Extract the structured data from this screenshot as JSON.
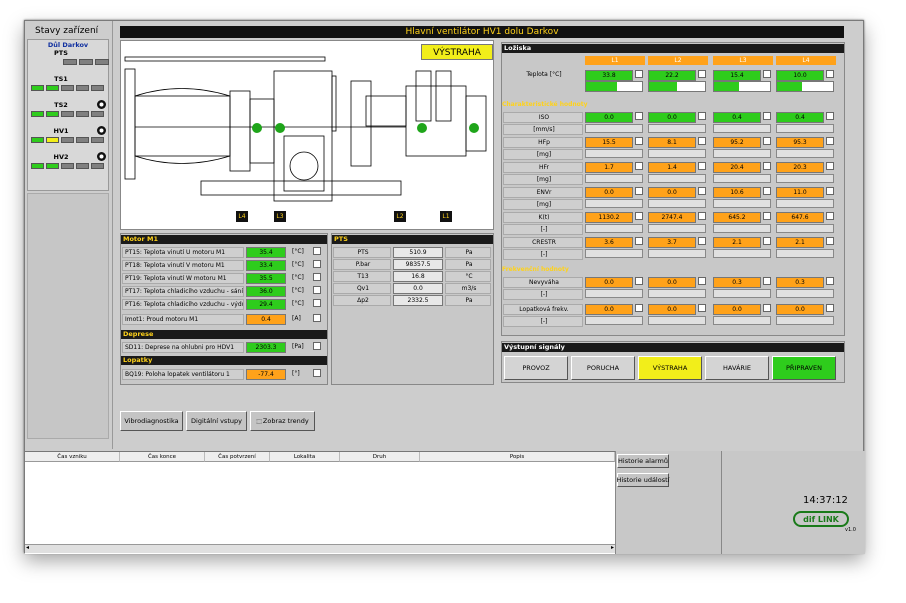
{
  "left_panel": {
    "title": "Stavy zařízení",
    "mine": "Důl Darkov",
    "items": [
      {
        "label": "PTS",
        "icon": false,
        "lamps": [
          "#808080",
          "#808080",
          "#808080"
        ]
      },
      {
        "label": "TS1",
        "icon": false,
        "lamps": [
          "#2ecc1c",
          "#2ecc1c",
          "#808080",
          "#808080",
          "#808080"
        ]
      },
      {
        "label": "TS2",
        "icon": true,
        "lamps": [
          "#2ecc1c",
          "#2ecc1c",
          "#808080",
          "#808080",
          "#808080"
        ]
      },
      {
        "label": "HV1",
        "icon": true,
        "lamps": [
          "#2ecc1c",
          "#f2ee1a",
          "#808080",
          "#808080",
          "#808080"
        ]
      },
      {
        "label": "HV2",
        "icon": true,
        "lamps": [
          "#2ecc1c",
          "#2ecc1c",
          "#808080",
          "#808080",
          "#808080"
        ]
      }
    ]
  },
  "header": {
    "title": "Hlavní ventilátor HV1 dolu Darkov"
  },
  "diagram": {
    "warning": "VÝSTRAHA",
    "bearings": [
      "L4",
      "L3",
      "L2",
      "L1"
    ]
  },
  "motor": {
    "title": "Motor M1",
    "rows": [
      {
        "label": "PT15: Teplota vinutí U motoru M1",
        "value": "35.4",
        "unit": "[°C]",
        "color": "#2ecc1c"
      },
      {
        "label": "PT18: Teplota vinutí V motoru M1",
        "value": "33.4",
        "unit": "[°C]",
        "color": "#2ecc1c"
      },
      {
        "label": "PT19: Teplota vinutí W motoru M1",
        "value": "35.5",
        "unit": "[°C]",
        "color": "#2ecc1c"
      },
      {
        "label": "PT17: Teplota chladicího vzduchu - sání",
        "value": "36.0",
        "unit": "[°C]",
        "color": "#2ecc1c"
      },
      {
        "label": "PT16: Teplota chladicího vzduchu - výdu",
        "value": "29.4",
        "unit": "[°C]",
        "color": "#2ecc1c"
      },
      {
        "label": "Imot1: Proud motoru M1",
        "value": "0.4",
        "unit": "[A]",
        "color": "#ffa21a"
      }
    ]
  },
  "deprese": {
    "title": "Deprese",
    "label": "SD11: Deprese na ohlubni pro HDV1",
    "value": "2303.3",
    "unit": "[Pa]"
  },
  "lopatky": {
    "title": "Lopatky",
    "label": "BQ19: Poloha lopatek ventilátoru 1",
    "value": "-77.4",
    "unit": "[°]"
  },
  "pts": {
    "title": "PTS",
    "rows": [
      {
        "label": "PTS",
        "value": "510.9",
        "unit": "Pa"
      },
      {
        "label": "P.bar",
        "value": "98357.5",
        "unit": "Pa"
      },
      {
        "label": "T13",
        "value": "16.8",
        "unit": "°C"
      },
      {
        "label": "Qv1",
        "value": "0.0",
        "unit": "m3/s"
      },
      {
        "label": "Δp2",
        "value": "2332.5",
        "unit": "Pa"
      }
    ]
  },
  "bottom_buttons": [
    "Vibrodiagnostika",
    "Digitální vstupy",
    "Zobraz trendy"
  ],
  "bearings": {
    "title": "Ložiska",
    "cols": [
      "L1",
      "L2",
      "L3",
      "L4"
    ],
    "teplota_label": "Teplota",
    "teplota_unit": "[°C]",
    "teplota": [
      "33.8",
      "22.2",
      "15.4",
      "10.0"
    ],
    "teplota_fill": [
      0.55,
      0.5,
      0.45,
      0.45
    ]
  },
  "char": {
    "title": "Charakteristické hodnoty",
    "rows": [
      {
        "label": "ISO",
        "unit": "[mm/s]",
        "values": [
          "0.0",
          "0.0",
          "0.4",
          "0.4"
        ],
        "colors": [
          "#2ecc1c",
          "#2ecc1c",
          "#2ecc1c",
          "#2ecc1c"
        ]
      },
      {
        "label": "HFp",
        "unit": "[mg]",
        "values": [
          "15.5",
          "8.1",
          "95.2",
          "95.3"
        ],
        "colors": [
          "#ffa21a",
          "#ffa21a",
          "#ffa21a",
          "#ffa21a"
        ]
      },
      {
        "label": "HFr",
        "unit": "[mg]",
        "values": [
          "1.7",
          "1.4",
          "20.4",
          "20.3"
        ],
        "colors": [
          "#ffa21a",
          "#ffa21a",
          "#ffa21a",
          "#ffa21a"
        ]
      },
      {
        "label": "ENVr",
        "unit": "[mg]",
        "values": [
          "0.0",
          "0.0",
          "10.6",
          "11.0"
        ],
        "colors": [
          "#ffa21a",
          "#ffa21a",
          "#ffa21a",
          "#ffa21a"
        ]
      },
      {
        "label": "K(t)",
        "unit": "[-]",
        "values": [
          "1130.2",
          "2747.4",
          "645.2",
          "647.6"
        ],
        "colors": [
          "#ffa21a",
          "#ffa21a",
          "#ffa21a",
          "#ffa21a"
        ]
      },
      {
        "label": "CRESTR",
        "unit": "[-]",
        "values": [
          "3.6",
          "3.7",
          "2.1",
          "2.1"
        ],
        "colors": [
          "#ffa21a",
          "#ffa21a",
          "#ffa21a",
          "#ffa21a"
        ]
      }
    ]
  },
  "freq": {
    "title": "Frekvenční hodnoty",
    "rows": [
      {
        "label": "Nevyváha",
        "unit": "[-]",
        "values": [
          "0.0",
          "0.0",
          "0.3",
          "0.3"
        ]
      },
      {
        "label": "Lopatková frekv.",
        "unit": "[-]",
        "values": [
          "0.0",
          "0.0",
          "0.0",
          "0.0"
        ]
      }
    ]
  },
  "signals": {
    "title": "Výstupní signály",
    "items": [
      {
        "label": "PROVOZ",
        "color": "#d4d4d4"
      },
      {
        "label": "PORUCHA",
        "color": "#d4d4d4"
      },
      {
        "label": "VÝSTRAHA",
        "color": "#f2ee1a"
      },
      {
        "label": "HAVÁRIE",
        "color": "#d4d4d4"
      },
      {
        "label": "PŘIPRAVEN",
        "color": "#2ecc1c"
      }
    ]
  },
  "alarm_table": {
    "columns": [
      "Čas vzniku",
      "Čas konce",
      "Čas potvrzení",
      "Lokalita",
      "Druh",
      "Popis"
    ],
    "buttons": [
      "Historie alarmů",
      "Historie událostí"
    ]
  },
  "clock": "14:37:12",
  "logo": {
    "text": "dif LINK",
    "version": "v1.0"
  }
}
